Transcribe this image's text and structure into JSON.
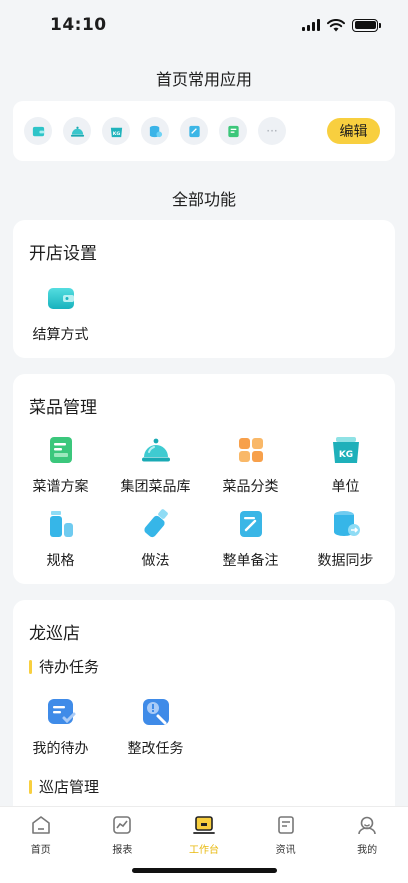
{
  "status": {
    "time": "14:10"
  },
  "favorites": {
    "title": "首页常用应用",
    "icons": [
      "wallet-icon",
      "dish-cover-icon",
      "kg-bag-icon",
      "database-sync-icon",
      "note-edit-icon",
      "recipe-icon"
    ],
    "more_label": "···",
    "edit_label": "编辑"
  },
  "all_title": "全部功能",
  "shop_setup": {
    "title": "开店设置",
    "items": [
      {
        "label": "结算方式",
        "icon": "wallet-icon"
      }
    ]
  },
  "dish_manage": {
    "title": "菜品管理",
    "items": [
      {
        "label": "菜谱方案",
        "icon": "recipe-icon"
      },
      {
        "label": "集团菜品库",
        "icon": "dish-cover-icon"
      },
      {
        "label": "菜品分类",
        "icon": "grid-icon"
      },
      {
        "label": "单位",
        "icon": "kg-bag-icon"
      },
      {
        "label": "规格",
        "icon": "cups-icon"
      },
      {
        "label": "做法",
        "icon": "bottle-icon"
      },
      {
        "label": "整单备注",
        "icon": "note-edit-icon"
      },
      {
        "label": "数据同步",
        "icon": "database-sync-icon"
      }
    ]
  },
  "patrol": {
    "title": "龙巡店",
    "todo_title": "待办任务",
    "todo_items": [
      {
        "label": "我的待办",
        "icon": "todo-check-icon"
      },
      {
        "label": "整改任务",
        "icon": "rectify-icon"
      }
    ],
    "manage_title": "巡店管理"
  },
  "tabs": [
    {
      "label": "首页",
      "icon": "home-icon",
      "active": false
    },
    {
      "label": "报表",
      "icon": "report-icon",
      "active": false
    },
    {
      "label": "工作台",
      "icon": "workbench-icon",
      "active": true
    },
    {
      "label": "资讯",
      "icon": "news-icon",
      "active": false
    },
    {
      "label": "我的",
      "icon": "profile-icon",
      "active": false
    }
  ],
  "colors": {
    "accent": "#f8cf3f",
    "active_tab": "#e8b90e",
    "background": "#f3f5f7"
  }
}
